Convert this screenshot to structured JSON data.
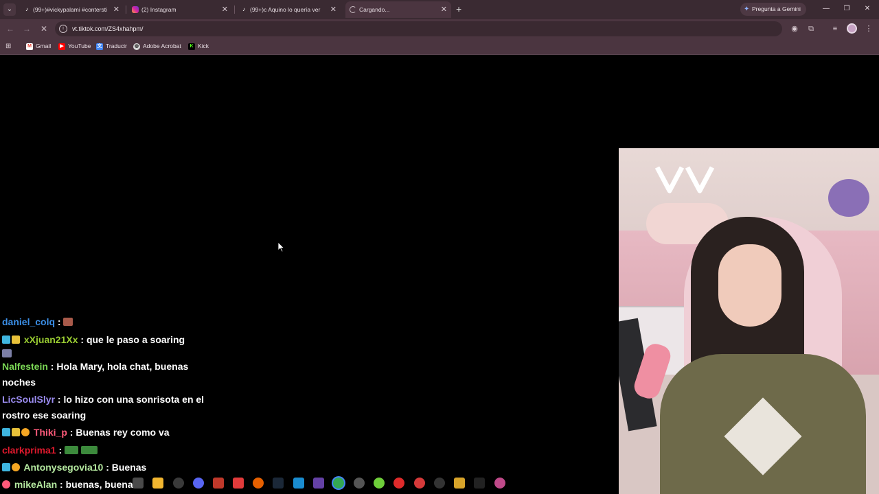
{
  "browser": {
    "tabs": [
      {
        "title": "(99+)#vickypalami #contersting",
        "icon": "tiktok-icon",
        "active": false
      },
      {
        "title": "(2) Instagram",
        "icon": "instagram-icon",
        "active": false
      },
      {
        "title": "(99+)c Aquino lo quería ver",
        "icon": "tiktok-icon",
        "active": false
      },
      {
        "title": "Cargando...",
        "icon": "loading-icon",
        "active": true
      }
    ],
    "gemini_label": "Pregunta a Gemini",
    "url": "vt.tiktok.com/ZS4xhahpm/",
    "bookmarks": [
      {
        "label": "Gmail",
        "icon": "gmail-icon",
        "color": "#ea4335"
      },
      {
        "label": "YouTube",
        "icon": "youtube-icon",
        "color": "#ff0000"
      },
      {
        "label": "Traducir",
        "icon": "translate-icon",
        "color": "#4285f4"
      },
      {
        "label": "Adobe Acrobat",
        "icon": "acrobat-icon",
        "color": "#bbbbbb"
      },
      {
        "label": "Kick",
        "icon": "kick-icon",
        "color": "#53fc18"
      }
    ]
  },
  "chat": {
    "messages": [
      {
        "user": "daniel_colq",
        "user_color": "#3b8fe8",
        "sep": " : ",
        "text": ""
      },
      {
        "user": "xXjuan21Xx",
        "user_color": "#9acd32",
        "sep": " : ",
        "text": "que le paso a soaring"
      },
      {
        "user": "Nalfestein",
        "user_color": "#7ad655",
        "sep": " : ",
        "text": "Hola Mary, hola chat, buenas noches"
      },
      {
        "user": "LicSoulSlyr",
        "user_color": "#9b8cf0",
        "sep": " : ",
        "text": "lo hizo con una sonrisota en el rostro ese soaring"
      },
      {
        "user": "Thiki_p",
        "user_color": "#ff5a7a",
        "sep": " : ",
        "text": "Buenas rey como va"
      },
      {
        "user": "clarkprima1",
        "user_color": "#e0192d",
        "sep": " : ",
        "text": ""
      },
      {
        "user": "Antonysegovia10",
        "user_color": "#b5e9a0",
        "sep": " : ",
        "text": "Buenas"
      },
      {
        "user": "mikeAlan",
        "user_color": "#b5e9a0",
        "sep": " : ",
        "text": "buenas, buenas!"
      }
    ]
  },
  "colors": {
    "tab_strip": "#3a2a32",
    "toolbar": "#4b3540",
    "page_bg": "#000000"
  }
}
